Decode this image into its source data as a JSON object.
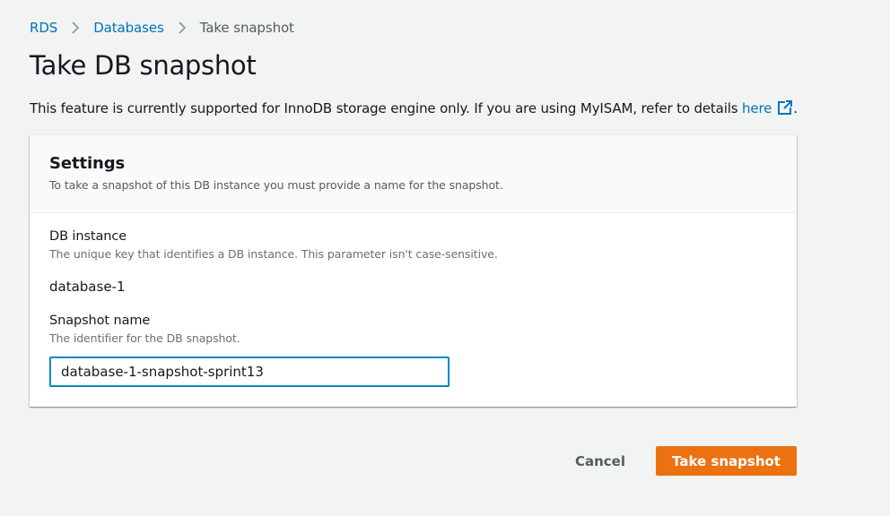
{
  "breadcrumb": {
    "items": [
      {
        "label": "RDS"
      },
      {
        "label": "Databases"
      }
    ],
    "current": "Take snapshot",
    "separator_icon": "chevron-right-icon"
  },
  "page": {
    "title": "Take DB snapshot",
    "info_text": "This feature is currently supported for InnoDB storage engine only. If you are using MyISAM, refer to details ",
    "info_link_label": "here",
    "info_link_icon": "external-link-icon",
    "info_suffix": "."
  },
  "settings": {
    "title": "Settings",
    "description": "To take a snapshot of this DB instance you must provide a name for the snapshot.",
    "db_instance": {
      "label": "DB instance",
      "description": "The unique key that identifies a DB instance. This parameter isn't case-sensitive.",
      "value": "database-1"
    },
    "snapshot_name": {
      "label": "Snapshot name",
      "description": "The identifier for the DB snapshot.",
      "value": "database-1-snapshot-sprint13"
    }
  },
  "actions": {
    "cancel_label": "Cancel",
    "submit_label": "Take snapshot"
  },
  "colors": {
    "link": "#0073bb",
    "primary_button": "#ec7211",
    "background": "#f2f3f3"
  }
}
